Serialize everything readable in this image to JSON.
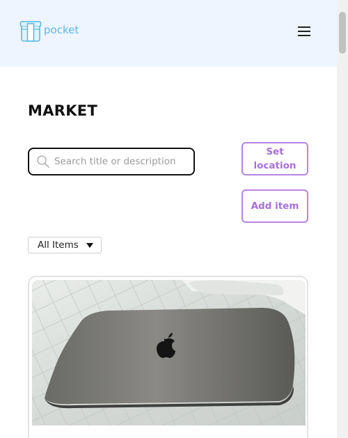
{
  "header": {
    "logo_text": "pocket",
    "logo_icon": "pocket-logo-icon",
    "menu_icon": "hamburger-menu-icon"
  },
  "main": {
    "title": "MARKET",
    "search": {
      "placeholder": "Search title or description",
      "value": ""
    },
    "set_location_label": "Set location",
    "add_item_label": "Add item",
    "filter": {
      "selected": "All Items"
    }
  },
  "colors": {
    "header_bg": "#eef5ff",
    "accent": "#a86fdb",
    "logo": "#5bb8e6"
  }
}
